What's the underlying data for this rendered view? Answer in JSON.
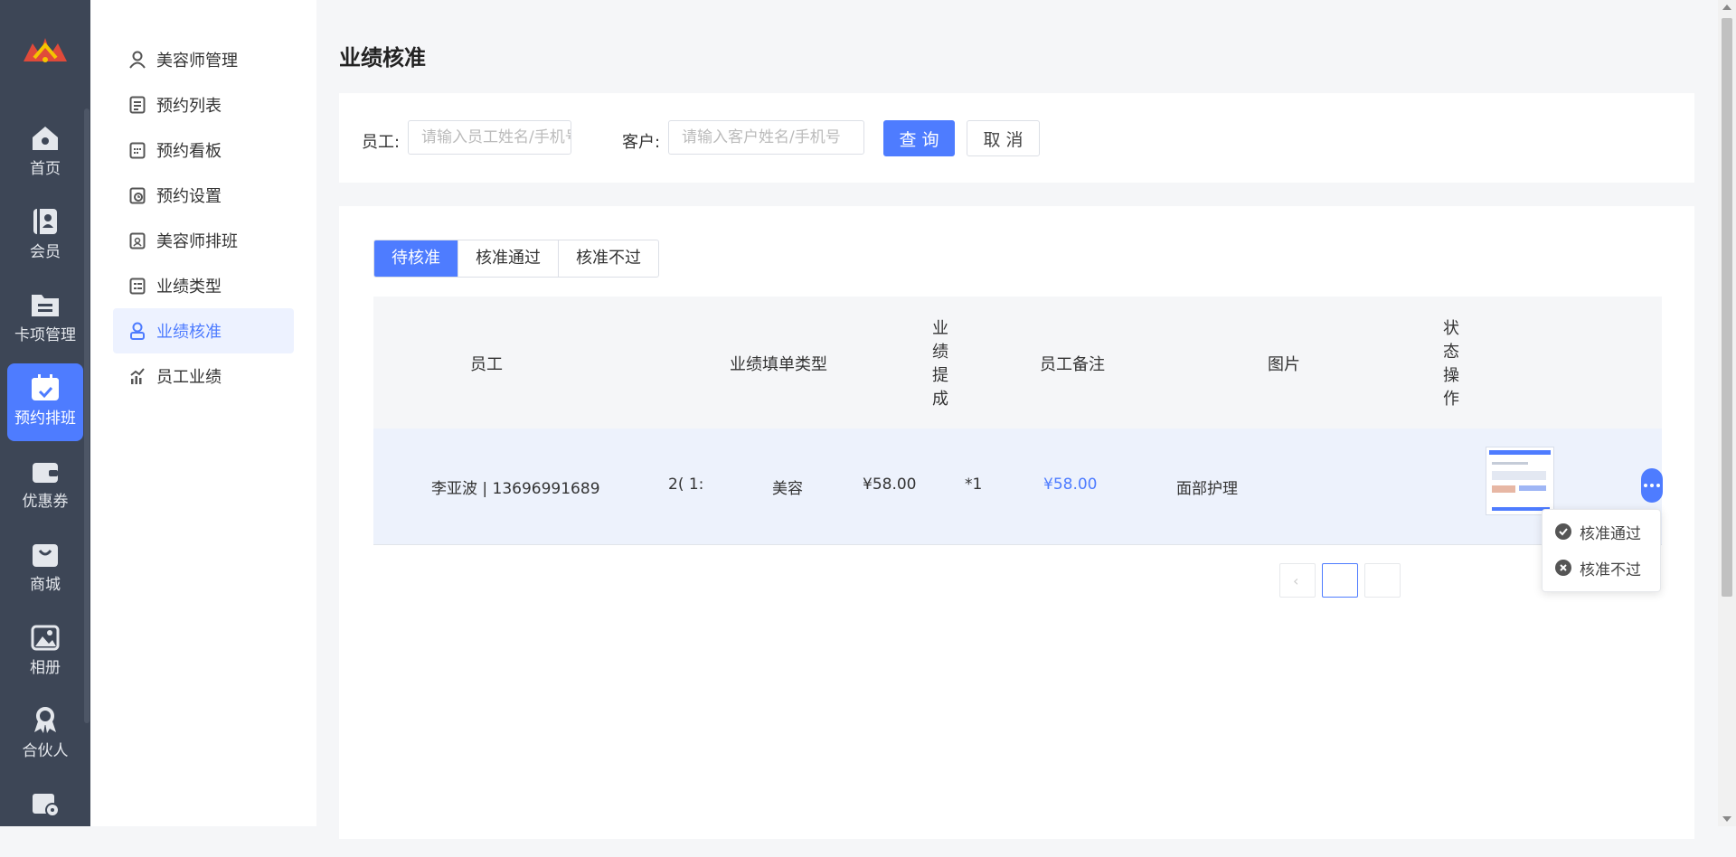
{
  "rail": {
    "items": [
      {
        "label": "首页",
        "icon": "home-icon"
      },
      {
        "label": "会员",
        "icon": "member-card-icon"
      },
      {
        "label": "卡项管理",
        "icon": "folder-icon"
      },
      {
        "label": "预约排班",
        "icon": "calendar-check-icon"
      },
      {
        "label": "优惠券",
        "icon": "wallet-icon"
      },
      {
        "label": "商城",
        "icon": "shopping-bag-icon"
      },
      {
        "label": "相册",
        "icon": "image-icon"
      },
      {
        "label": "合伙人",
        "icon": "partner-icon"
      },
      {
        "label": "",
        "icon": "store-settings-icon"
      }
    ],
    "active_index": 3
  },
  "subnav": {
    "items": [
      {
        "label": "美容师管理",
        "icon": "user-icon"
      },
      {
        "label": "预约列表",
        "icon": "list-icon"
      },
      {
        "label": "预约看板",
        "icon": "board-icon"
      },
      {
        "label": "预约设置",
        "icon": "clock-settings-icon"
      },
      {
        "label": "美容师排班",
        "icon": "schedule-icon"
      },
      {
        "label": "业绩类型",
        "icon": "type-icon"
      },
      {
        "label": "业绩核准",
        "icon": "approve-user-icon"
      },
      {
        "label": "员工业绩",
        "icon": "chart-icon"
      }
    ],
    "active_index": 6
  },
  "page": {
    "title": "业绩核准"
  },
  "filter": {
    "employee_label": "员工:",
    "employee_placeholder": "请输入员工姓名/手机号",
    "customer_label": "客户:",
    "customer_placeholder": "请输入客户姓名/手机号",
    "query_label": "查 询",
    "cancel_label": "取 消"
  },
  "tabs": [
    {
      "label": "待核准",
      "active": true
    },
    {
      "label": "核准通过",
      "active": false
    },
    {
      "label": "核准不过",
      "active": false
    }
  ],
  "table": {
    "headers": {
      "employee": "员工",
      "type": "业绩填单类型",
      "commission": "业\n绩\n提\n成",
      "remark": "员工备注",
      "image": "图片",
      "status_op": "状\n态\n操\n作"
    },
    "rows": [
      {
        "employee": "李亚波 | 13696991689",
        "date_fragment": "2(  1:",
        "type": "美容",
        "price": "¥58.00",
        "qty": "*1",
        "commission": "¥58.00",
        "remark": "面部护理"
      }
    ]
  },
  "dropdown": {
    "approve_label": "核准通过",
    "reject_label": "核准不过"
  },
  "colors": {
    "primary": "#4e7cff",
    "rail_bg": "#3d4656"
  }
}
